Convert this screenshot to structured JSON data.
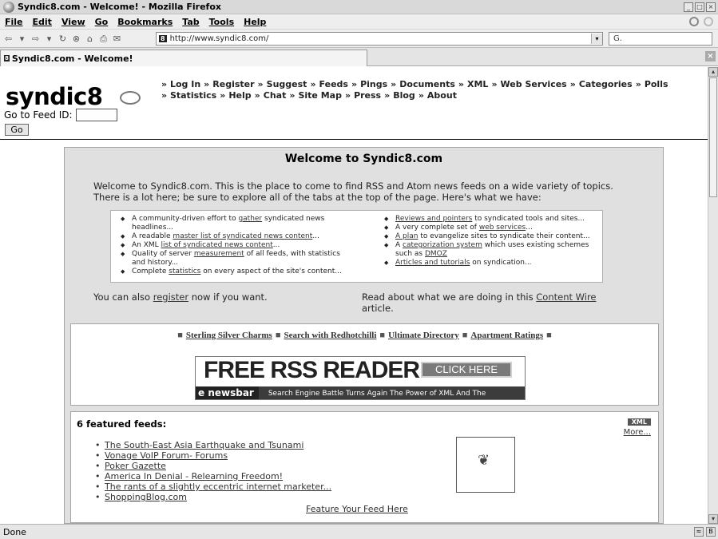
{
  "window": {
    "title": "Syndic8.com - Welcome! - Mozilla Firefox"
  },
  "menu": [
    "File",
    "Edit",
    "View",
    "Go",
    "Bookmarks",
    "Tab",
    "Tools",
    "Help"
  ],
  "nav": {
    "url": "http://www.syndic8.com/",
    "search_value": "G."
  },
  "tab": {
    "label": "Syndic8.com - Welcome!"
  },
  "status": {
    "text": "Done"
  },
  "header": {
    "logo_text": "syndic",
    "logo_digit": "8",
    "feed_id_label": "Go to Feed ID:",
    "go_label": "Go",
    "nav_links_row1": [
      "Log In",
      "Register",
      "Suggest",
      "Feeds",
      "Pings",
      "Documents",
      "XML",
      "Web Services",
      "Categories",
      "Polls"
    ],
    "nav_links_row2": [
      "Statistics",
      "Help",
      "Chat",
      "Site Map",
      "Press",
      "Blog",
      "About"
    ],
    "nav_prefix": "»"
  },
  "main": {
    "title": "Welcome to Syndic8.com",
    "intro_line1": "Welcome to Syndic8.com. This is the place to come to find RSS and Atom news feeds on a wide variety of topics.",
    "intro_line2": "There is a lot here; be sure to explore all of the tabs at the top of the page. Here's what we have:",
    "features_left": [
      {
        "pre": "A community-driven effort to ",
        "link": "gather",
        "post": " syndicated news headlines..."
      },
      {
        "pre": "A readable ",
        "link": "master list of syndicated news content",
        "post": "..."
      },
      {
        "pre": "An XML ",
        "link": "list of syndicated news content",
        "post": "..."
      },
      {
        "pre": "Quality of server ",
        "link": "measurement",
        "post": " of all feeds, with statistics and history..."
      },
      {
        "pre": "Complete ",
        "link": "statistics",
        "post": " on every aspect of the site's content..."
      }
    ],
    "features_right": [
      {
        "pre": "",
        "link": "Reviews and pointers",
        "post": " to syndicated tools and sites..."
      },
      {
        "pre": "A very complete set of ",
        "link": "web services",
        "post": "..."
      },
      {
        "pre": "",
        "link": "A plan",
        "post": " to evangelize sites to syndicate their content..."
      },
      {
        "pre": "A ",
        "link": "categorization system",
        "post": " which uses existing schemes such as ",
        "link2": "DMOZ"
      },
      {
        "pre": "",
        "link": "Articles and tutorials",
        "post": " on syndication..."
      }
    ],
    "register_pre": "You can also ",
    "register_link": "register",
    "register_post": " now if you want.",
    "content_wire_pre": "Read about what we are doing in this ",
    "content_wire_link": "Content Wire",
    "content_wire_post": " article."
  },
  "ads": {
    "links": [
      "Sterling Silver Charms",
      "Search with Redhotchilli",
      "Ultimate Directory",
      "Apartment Ratings"
    ],
    "bullet": "■",
    "banner_title": "FREE RSS READER",
    "banner_button": "CLICK HERE",
    "banner_brand": "e newsbar",
    "banner_ticker": "Search Engine Battle Turns Again     The Power of XML And The"
  },
  "featured": {
    "title": "6 featured feeds:",
    "xml_badge": "XML",
    "more": "More...",
    "feeds": [
      "The South-East Asia Earthquake and Tsunami",
      "Vonage VoIP Forum- Forums",
      "Poker Gazette",
      "America In Denial - Relearning Freedom!",
      "The rants of a slightly eccentric internet marketer...",
      "ShoppingBlog.com"
    ],
    "feature_link": "Feature Your Feed Here"
  }
}
